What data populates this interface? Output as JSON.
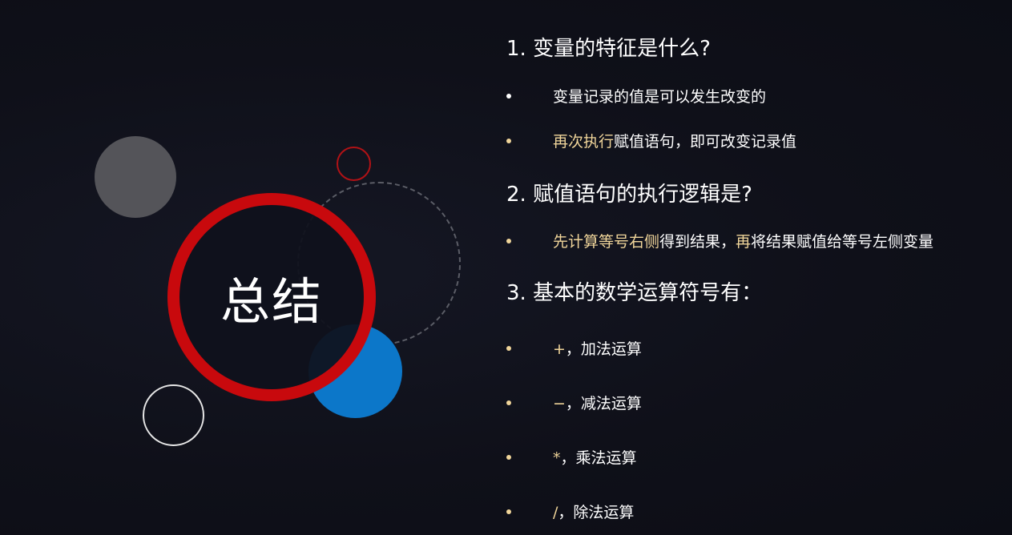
{
  "title": "总结",
  "q1": {
    "heading": "1. 变量的特征是什么?",
    "b1": "变量记录的值是可以发生改变的",
    "b2_hl": "再次执行",
    "b2_rest": "赋值语句，即可改变记录值"
  },
  "q2": {
    "heading": "2. 赋值语句的执行逻辑是?",
    "b1_hl1": "先计算等号右侧",
    "b1_mid": "得到结果，",
    "b1_hl2": "再",
    "b1_rest": "将结果赋值给等号左侧变量"
  },
  "q3": {
    "heading": "3. 基本的数学运算符号有：",
    "items": [
      {
        "symbol": "+",
        "text": "，加法运算"
      },
      {
        "symbol": "−",
        "text": "，减法运算"
      },
      {
        "symbol": "*",
        "text": "，乘法运算"
      },
      {
        "symbol": "/",
        "text": "，除法运算"
      }
    ]
  },
  "colors": {
    "background": "#0e0f18",
    "accent_red": "#c8090d",
    "accent_blue": "#0c77c9",
    "highlight_gold": "#f0d59a"
  }
}
